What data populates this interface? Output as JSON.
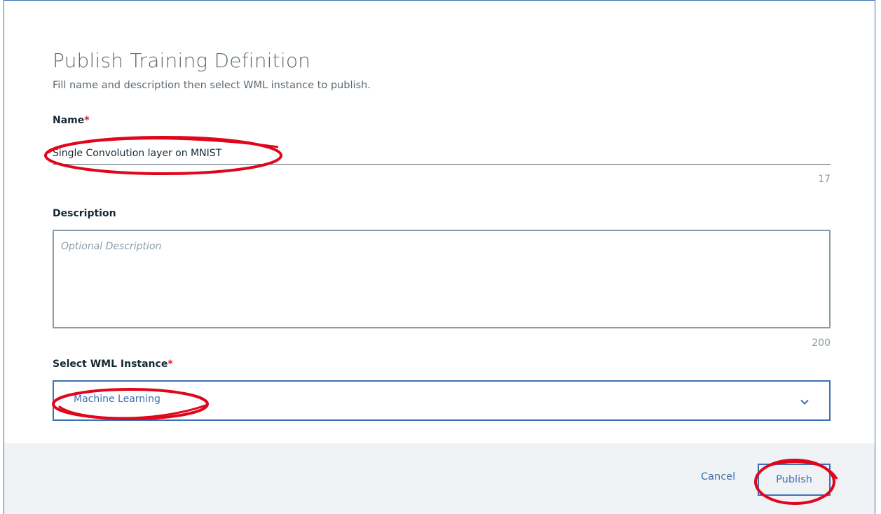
{
  "dialog": {
    "title": "Publish Training Definition",
    "subtitle": "Fill name and description then select WML instance to publish."
  },
  "name_field": {
    "label": "Name",
    "required_mark": "*",
    "value": "Single Convolution layer on MNIST",
    "counter": "17"
  },
  "description_field": {
    "label": "Description",
    "placeholder": "Optional Description",
    "counter": "200"
  },
  "wml_select": {
    "label": "Select WML Instance",
    "required_mark": "*",
    "selected": "Machine Learning"
  },
  "footer": {
    "cancel_label": "Cancel",
    "publish_label": "Publish"
  },
  "colors": {
    "accent": "#3d70b2",
    "required": "#e0182d",
    "annotation": "#e0061b"
  },
  "icons": {
    "select_arrow": "chevron-down-icon"
  }
}
